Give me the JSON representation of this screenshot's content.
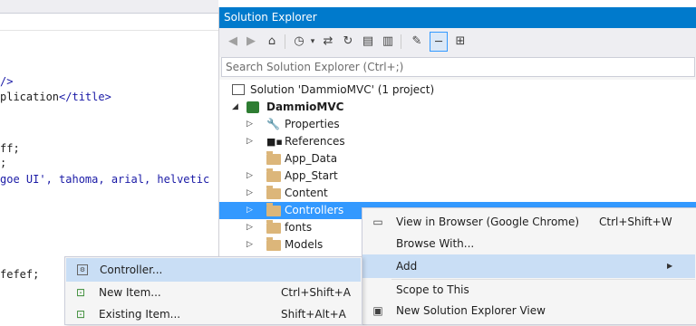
{
  "editor": {
    "lines": [
      {
        "text": "/>",
        "color": "#1a1aa6"
      },
      {
        "pre": "plication",
        "tag": "</title>",
        "color": "#1e1e1e"
      },
      {
        "text": "ff;",
        "color": "#1e1e1e"
      },
      {
        "text": ";",
        "color": "#1e1e1e"
      },
      {
        "text": "goe UI', tahoma, arial, helvetic",
        "color": "#1a1aa6"
      },
      {
        "text": "fefef;",
        "color": "#1e1e1e"
      }
    ]
  },
  "solution_explorer": {
    "title": "Solution Explorer",
    "search_placeholder": "Search Solution Explorer (Ctrl+;)",
    "toolbar_icons": [
      "back-icon",
      "forward-icon",
      "home-icon",
      "history-icon",
      "dropdown-icon",
      "sync-icon",
      "refresh-icon",
      "collapse-icon",
      "show-all-files-icon",
      "properties-icon",
      "pin-icon",
      "class-diagram-icon"
    ],
    "tree": [
      {
        "label": "Solution 'DammioMVC' (1 project)",
        "icon": "solution-icon",
        "bold": false
      },
      {
        "label": "DammioMVC",
        "icon": "web-project-icon",
        "bold": true
      },
      {
        "label": "Properties",
        "icon": "wrench-icon"
      },
      {
        "label": "References",
        "icon": "references-icon"
      },
      {
        "label": "App_Data",
        "icon": "folder-icon"
      },
      {
        "label": "App_Start",
        "icon": "folder-icon"
      },
      {
        "label": "Content",
        "icon": "folder-icon"
      },
      {
        "label": "Controllers",
        "icon": "folder-icon",
        "selected": true
      },
      {
        "label": "fonts",
        "icon": "folder-icon"
      },
      {
        "label": "Models",
        "icon": "folder-icon"
      }
    ]
  },
  "context_menu": {
    "items": [
      {
        "label": "View in Browser (Google Chrome)",
        "shortcut": "Ctrl+Shift+W",
        "icon": "browser-icon"
      },
      {
        "label": "Browse With...",
        "shortcut": ""
      },
      {
        "label": "Add",
        "shortcut": "",
        "submenu": true
      },
      {
        "label": "Scope to This",
        "shortcut": ""
      },
      {
        "label": "New Solution Explorer View",
        "shortcut": "",
        "icon": "new-view-icon"
      }
    ]
  },
  "add_submenu": {
    "items": [
      {
        "label": "Controller...",
        "shortcut": "",
        "icon": "controller-icon"
      },
      {
        "label": "New Item...",
        "shortcut": "Ctrl+Shift+A",
        "icon": "new-item-icon"
      },
      {
        "label": "Existing Item...",
        "shortcut": "Shift+Alt+A",
        "icon": "existing-item-icon"
      }
    ]
  }
}
